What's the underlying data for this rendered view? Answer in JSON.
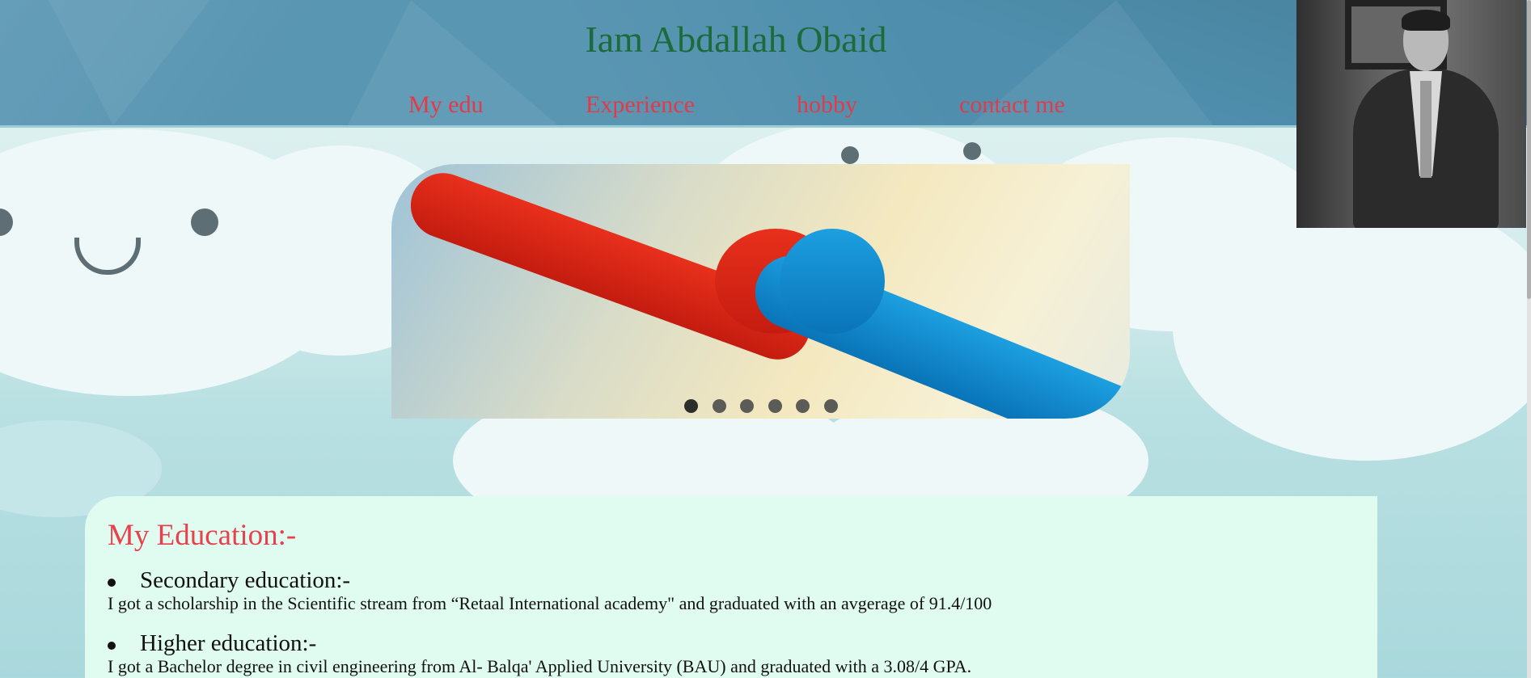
{
  "header": {
    "title": "Iam Abdallah Obaid",
    "nav": [
      {
        "label": "My edu"
      },
      {
        "label": "Experience"
      },
      {
        "label": "hobby"
      },
      {
        "label": "contact me"
      }
    ]
  },
  "carousel": {
    "slide_count": 6,
    "active_index": 0
  },
  "education": {
    "heading": "My Education:-",
    "items": [
      {
        "title": "Secondary education:-",
        "text": "I got a scholarship in the Scientific stream from “Retaal International academy\" and graduated with an avgerage of 91.4/100"
      },
      {
        "title": "Higher education:-",
        "text": "I got a Bachelor degree in civil engineering from Al- Balqa' Applied University (BAU) and graduated with a 3.08/4 GPA."
      }
    ]
  },
  "colors": {
    "header_bg": "#4f8fad",
    "title": "#1d6b3a",
    "nav": "#e33a4a",
    "edu_card": "#e0fbef",
    "edu_heading": "#e8404c"
  }
}
